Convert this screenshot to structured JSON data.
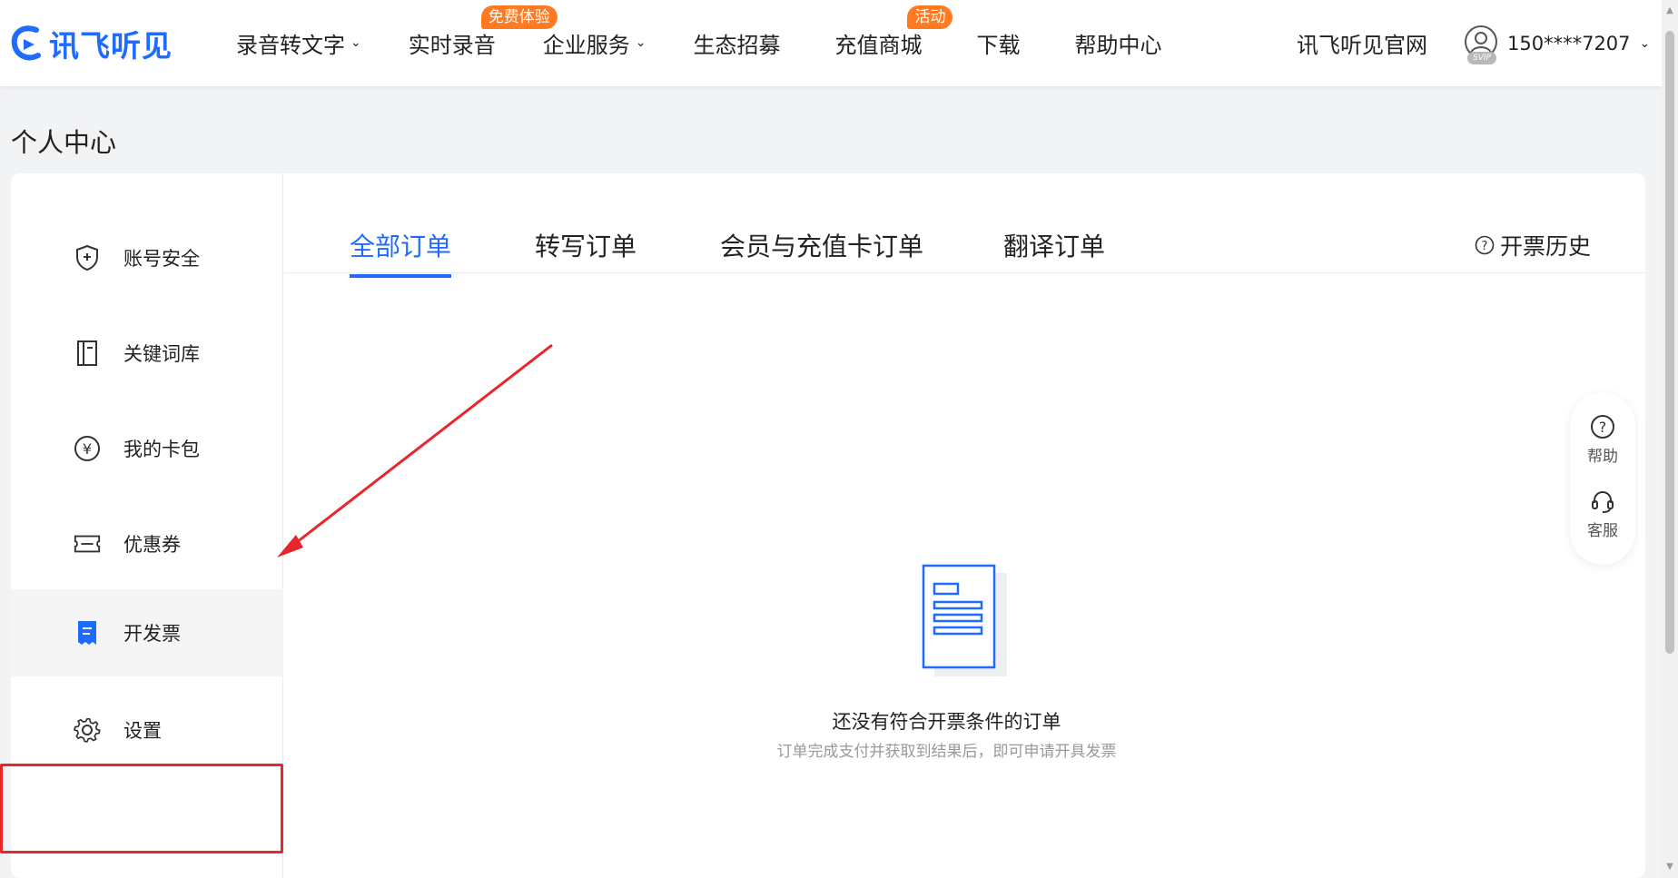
{
  "logo": {
    "text": "讯飞听见"
  },
  "nav": {
    "items": [
      {
        "label": "录音转文字",
        "dropdown": true
      },
      {
        "label": "实时录音",
        "badge": "免费体验"
      },
      {
        "label": "企业服务",
        "dropdown": true
      },
      {
        "label": "生态招募"
      },
      {
        "label": "充值商城",
        "badge": "活动"
      },
      {
        "label": "下载"
      },
      {
        "label": "帮助中心"
      }
    ],
    "official": "讯飞听见官网",
    "user": {
      "phone": "150****7207",
      "vip": "SVIP"
    }
  },
  "page": {
    "title": "个人中心"
  },
  "sidebar": {
    "items": [
      {
        "label": "账号安全",
        "icon": "shield-icon"
      },
      {
        "label": "关键词库",
        "icon": "notebook-icon"
      },
      {
        "label": "我的卡包",
        "icon": "yen-circle-icon"
      },
      {
        "label": "优惠券",
        "icon": "ticket-icon"
      },
      {
        "label": "开发票",
        "icon": "invoice-icon",
        "active": true
      },
      {
        "label": "设置",
        "icon": "gear-icon"
      }
    ]
  },
  "tabs": {
    "items": [
      {
        "label": "全部订单",
        "active": true
      },
      {
        "label": "转写订单"
      },
      {
        "label": "会员与充值卡订单"
      },
      {
        "label": "翻译订单"
      }
    ],
    "invoice_history": "开票历史"
  },
  "empty": {
    "title": "还没有符合开票条件的订单",
    "subtitle": "订单完成支付并获取到结果后，即可申请开具发票"
  },
  "float_help": {
    "help": "帮助",
    "service": "客服"
  },
  "colors": {
    "accent": "#1f6bff",
    "badge": "#ff7a21",
    "annotation": "#e8262b"
  }
}
